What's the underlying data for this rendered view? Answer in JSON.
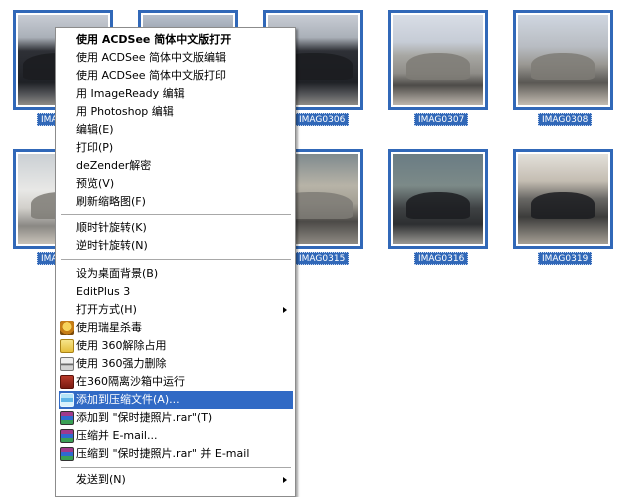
{
  "thumbnails": [
    {
      "label": "IMAG",
      "photo": "dark-car-front"
    },
    {
      "label": "",
      "photo": "dark-car-front"
    },
    {
      "label": "IMAG0306",
      "photo": "dark-car-front"
    },
    {
      "label": "IMAG0307",
      "photo": "suv-side"
    },
    {
      "label": "IMAG0308",
      "photo": "suv-side-doors-open"
    },
    {
      "label": "IMAG",
      "photo": "white-suv"
    },
    {
      "label": "IMAG0315",
      "photo": "suv-front"
    },
    {
      "label": "IMAG0316",
      "photo": "silver-suv"
    },
    {
      "label": "IMAG0319",
      "photo": "suv-rear"
    }
  ],
  "context_menu": {
    "items": [
      {
        "label": "使用 ACDSee 简体中文版打开",
        "bold": true
      },
      {
        "label": "使用 ACDSee 简体中文版编辑"
      },
      {
        "label": "使用 ACDSee 简体中文版打印"
      },
      {
        "label": "用 ImageReady 编辑"
      },
      {
        "label": "用 Photoshop 编辑"
      },
      {
        "label": "编辑(E)"
      },
      {
        "label": "打印(P)"
      },
      {
        "label": "deZender解密"
      },
      {
        "label": "预览(V)"
      },
      {
        "label": "刷新缩略图(F)"
      },
      {
        "label": "顺时针旋转(K)"
      },
      {
        "label": "逆时针旋转(N)"
      },
      {
        "label": "设为桌面背景(B)"
      },
      {
        "label": "EditPlus 3"
      },
      {
        "label": "打开方式(H)",
        "submenu": true
      },
      {
        "label": "使用瑞星杀毒",
        "icon": "shield-icon"
      },
      {
        "label": "使用 360解除占用",
        "icon": "folder-icon"
      },
      {
        "label": "使用 360强力删除",
        "icon": "shredder-icon"
      },
      {
        "label": "在360隔离沙箱中运行",
        "icon": "sandbox-icon"
      },
      {
        "label": "添加到压缩文件(A)...",
        "icon": "winrar-icon",
        "highlighted": true
      },
      {
        "label": "添加到 \"保时捷照片.rar\"(T)",
        "icon": "winrar-icon"
      },
      {
        "label": "压缩并 E-mail...",
        "icon": "winrar-icon"
      },
      {
        "label": "压缩到 \"保时捷照片.rar\" 并 E-mail",
        "icon": "winrar-icon"
      },
      {
        "label": "发送到(N)",
        "submenu": true
      }
    ]
  },
  "colors": {
    "selection": "#316ac5",
    "thumbnail_border": "#3168b8"
  }
}
